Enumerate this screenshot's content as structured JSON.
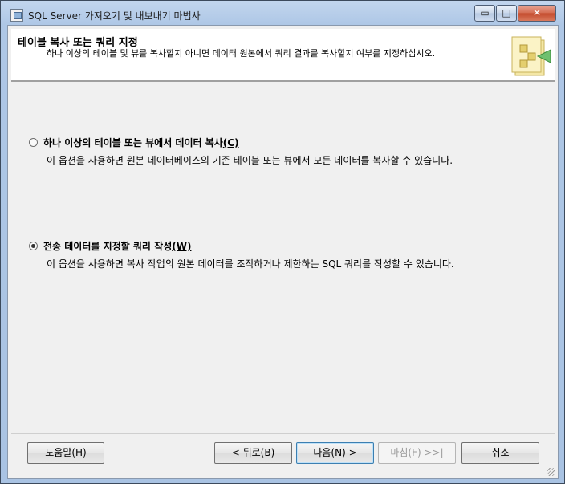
{
  "window": {
    "title": "SQL Server 가져오기 및 내보내기 마법사",
    "minimize_glyph": "▭",
    "maximize_glyph": "□",
    "close_glyph": "✕"
  },
  "header": {
    "title": "테이블 복사 또는 쿼리 지정",
    "subtitle": "하나 이상의 테이블 및 뷰를 복사할지 아니면 데이터 원본에서 쿼리 결과를 복사할지 여부를 지정하십시오."
  },
  "options": [
    {
      "label": "하나 이상의 테이블 또는 뷰에서 데이터 복사",
      "mnemonic": "(C)",
      "description": "이 옵션을 사용하면 원본 데이터베이스의 기존 테이블 또는 뷰에서 모든 데이터를 복사할 수 있습니다.",
      "checked": false
    },
    {
      "label": "전송 데이터를 지정할 쿼리 작성",
      "mnemonic": "(W)",
      "description": "이 옵션을 사용하면 복사 작업의 원본 데이터를 조작하거나 제한하는 SQL 쿼리를 작성할 수 있습니다.",
      "checked": true
    }
  ],
  "buttons": {
    "help": "도움말(H)",
    "back": "< 뒤로(B)",
    "next": "다음(N) >",
    "finish": "마침(F) >>|",
    "cancel": "취소"
  },
  "colors": {
    "title_bar": "#aec7e6",
    "client_background": "#f0f0f0",
    "header_background": "#ffffff",
    "default_button_border": "#3c7fb1"
  },
  "icons": {
    "app": "wizard-app-icon",
    "header_art": "data-transfer-folder-icon"
  }
}
